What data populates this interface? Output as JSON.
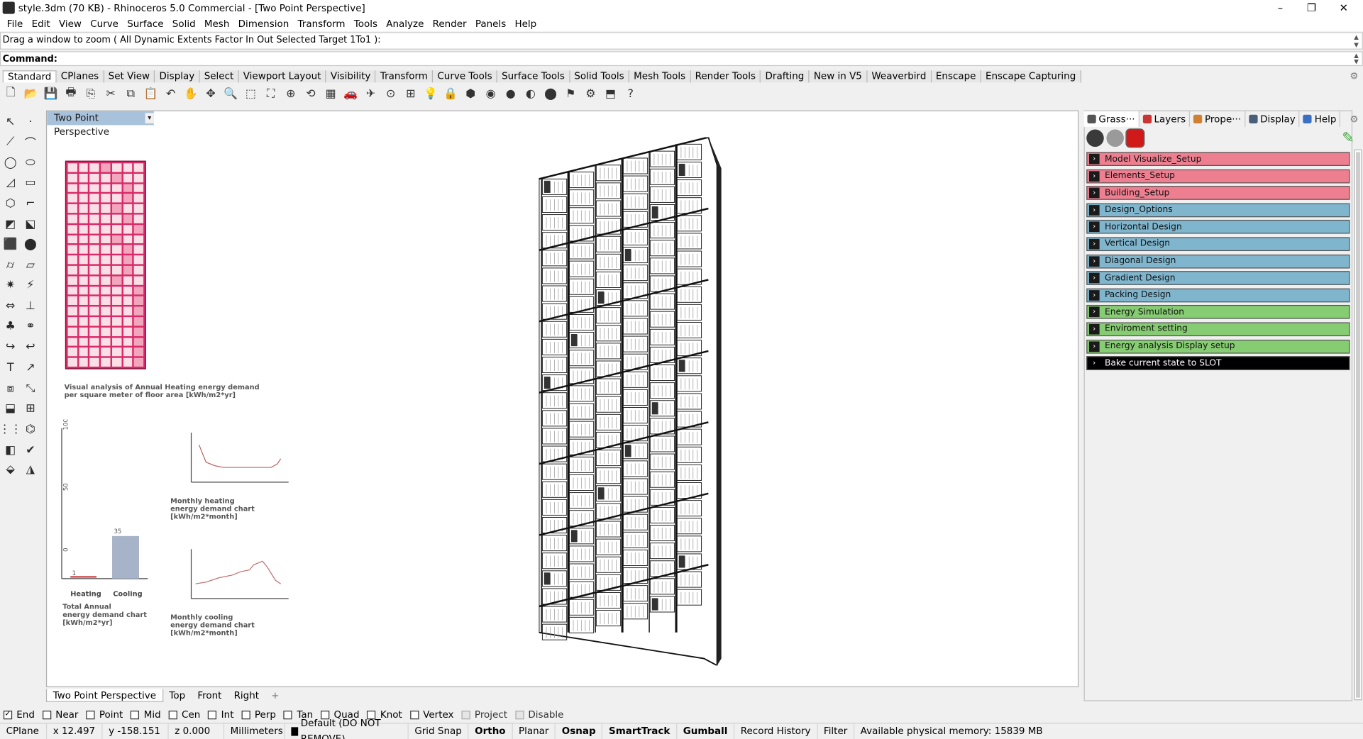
{
  "window": {
    "title": "style.3dm (70 KB) - Rhinoceros 5.0 Commercial - [Two Point Perspective]",
    "minimize_glyph": "–",
    "maximize_glyph": "❐",
    "close_glyph": "✕"
  },
  "menu": [
    "File",
    "Edit",
    "View",
    "Curve",
    "Surface",
    "Solid",
    "Mesh",
    "Dimension",
    "Transform",
    "Tools",
    "Analyze",
    "Render",
    "Panels",
    "Help"
  ],
  "command": {
    "history": "Drag a window to zoom ( All  Dynamic  Extents  Factor  In  Out  Selected  Target  1To1 ):",
    "label": "Command:",
    "value": ""
  },
  "toolbar_tabs": [
    "Standard",
    "CPlanes",
    "Set View",
    "Display",
    "Select",
    "Viewport Layout",
    "Visibility",
    "Transform",
    "Curve Tools",
    "Surface Tools",
    "Solid Tools",
    "Mesh Tools",
    "Render Tools",
    "Drafting",
    "New in V5",
    "Weaverbird",
    "Enscape",
    "Enscape Capturing"
  ],
  "toolbar_icons": [
    {
      "name": "new-file-icon",
      "glyph": "🗋"
    },
    {
      "name": "open-icon",
      "glyph": "📂"
    },
    {
      "name": "save-icon",
      "glyph": "💾"
    },
    {
      "name": "print-icon",
      "glyph": "🖶"
    },
    {
      "name": "export-icon",
      "glyph": "⎘"
    },
    {
      "name": "cut-icon",
      "glyph": "✂"
    },
    {
      "name": "copy-icon",
      "glyph": "⧉"
    },
    {
      "name": "paste-icon",
      "glyph": "📋"
    },
    {
      "name": "undo-icon",
      "glyph": "↶"
    },
    {
      "name": "pan-icon",
      "glyph": "✋"
    },
    {
      "name": "rotate-view-icon",
      "glyph": "✥"
    },
    {
      "name": "zoom-icon",
      "glyph": "🔍"
    },
    {
      "name": "zoom-window-icon",
      "glyph": "⬚"
    },
    {
      "name": "zoom-extents-icon",
      "glyph": "⛶"
    },
    {
      "name": "zoom-selected-icon",
      "glyph": "⊕"
    },
    {
      "name": "undo-view-icon",
      "glyph": "⟲"
    },
    {
      "name": "viewport-layout-icon",
      "glyph": "▦"
    },
    {
      "name": "car-icon",
      "glyph": "🚗"
    },
    {
      "name": "plane-icon",
      "glyph": "✈"
    },
    {
      "name": "cplane-icon",
      "glyph": "⊙"
    },
    {
      "name": "grid-icon",
      "glyph": "⊞"
    },
    {
      "name": "light-icon",
      "glyph": "💡"
    },
    {
      "name": "lock-icon",
      "glyph": "🔒"
    },
    {
      "name": "material-icon",
      "glyph": "⬢"
    },
    {
      "name": "color-icon",
      "glyph": "◉"
    },
    {
      "name": "shade-icon",
      "glyph": "●"
    },
    {
      "name": "rendered-icon",
      "glyph": "◐"
    },
    {
      "name": "sphere-icon",
      "glyph": "⬤"
    },
    {
      "name": "flag-icon",
      "glyph": "⚑"
    },
    {
      "name": "options-icon",
      "glyph": "⚙"
    },
    {
      "name": "properties-icon",
      "glyph": "⬒"
    },
    {
      "name": "help-icon",
      "glyph": "?"
    }
  ],
  "left_tools": [
    {
      "name": "select-icon",
      "glyph": "↖"
    },
    {
      "name": "point-icon",
      "glyph": "·"
    },
    {
      "name": "polyline-icon",
      "glyph": "⟋"
    },
    {
      "name": "curve-icon",
      "glyph": "⌒"
    },
    {
      "name": "circle-icon",
      "glyph": "◯"
    },
    {
      "name": "ellipse-icon",
      "glyph": "⬭"
    },
    {
      "name": "arc-icon",
      "glyph": "◿"
    },
    {
      "name": "rectangle-icon",
      "glyph": "▭"
    },
    {
      "name": "polygon-icon",
      "glyph": "⬡"
    },
    {
      "name": "fillet-icon",
      "glyph": "⌐"
    },
    {
      "name": "surface-icon",
      "glyph": "◩"
    },
    {
      "name": "extrude-icon",
      "glyph": "⬕"
    },
    {
      "name": "box-icon",
      "glyph": "⬛"
    },
    {
      "name": "boolean-icon",
      "glyph": "⬤"
    },
    {
      "name": "cylinder-icon",
      "glyph": "⌭"
    },
    {
      "name": "plane-surface-icon",
      "glyph": "▱"
    },
    {
      "name": "gear-tool-icon",
      "glyph": "✷"
    },
    {
      "name": "lightning-icon",
      "glyph": "⚡"
    },
    {
      "name": "move-icon",
      "glyph": "⇔"
    },
    {
      "name": "transform-icon",
      "glyph": "⊥"
    },
    {
      "name": "group-icon",
      "glyph": "♣"
    },
    {
      "name": "ungroup-icon",
      "glyph": "⚭"
    },
    {
      "name": "pipe-icon",
      "glyph": "↪"
    },
    {
      "name": "sweep-icon",
      "glyph": "↩"
    },
    {
      "name": "text-icon",
      "glyph": "T"
    },
    {
      "name": "dimension-icon",
      "glyph": "↗"
    },
    {
      "name": "block-icon",
      "glyph": "⧈"
    },
    {
      "name": "scale-icon",
      "glyph": "⤡"
    },
    {
      "name": "mesh-icon",
      "glyph": "⬓"
    },
    {
      "name": "hatch-icon",
      "glyph": "⊞"
    },
    {
      "name": "array-icon",
      "glyph": "⋮⋮"
    },
    {
      "name": "gumball-icon",
      "glyph": "⌬"
    },
    {
      "name": "cage-icon",
      "glyph": "◧"
    },
    {
      "name": "check-icon",
      "glyph": "✔"
    },
    {
      "name": "render-tool-icon",
      "glyph": "⬙"
    },
    {
      "name": "paint-icon",
      "glyph": "◮"
    }
  ],
  "viewport": {
    "title": "Two Point Perspective",
    "dropdown_glyph": "▾",
    "annual_caption_1": "Visual analysis of Annual Heating energy demand",
    "annual_caption_2": "per square meter of floor area [kWh/m2*yr]",
    "bar_axis_100": "100",
    "bar_axis_50": "50",
    "bar_axis_0": "0",
    "bar_value_heating": "1",
    "bar_value_cooling": "35",
    "bar_label_heating": "Heating",
    "bar_label_cooling": "Cooling",
    "total_caption_1": "Total Annual",
    "total_caption_2": "energy demand chart",
    "total_caption_3": "[kWh/m2*yr]",
    "heating_caption_1": "Monthly heating",
    "heating_caption_2": "energy demand chart",
    "heating_caption_3": "[kWh/m2*month]",
    "cooling_caption_1": "Monthly cooling",
    "cooling_caption_2": "energy demand chart",
    "cooling_caption_3": "[kWh/m2*month]"
  },
  "viewport_tabs": [
    "Two Point Perspective",
    "Top",
    "Front",
    "Right"
  ],
  "add_tab_glyph": "+",
  "panel_tabs": [
    {
      "label": "Grass···",
      "color": "#555555"
    },
    {
      "label": "Layers",
      "color": "#cc3333"
    },
    {
      "label": "Prope···",
      "color": "#d08030"
    },
    {
      "label": "Display",
      "color": "#4a5d7a"
    },
    {
      "label": "Help",
      "color": "#3a6fc4"
    }
  ],
  "grasshopper_groups": [
    {
      "label": "Model Visualize_Setup",
      "color": "pink"
    },
    {
      "label": "Elements_Setup",
      "color": "pink"
    },
    {
      "label": "Building_Setup",
      "color": "pink"
    },
    {
      "label": "Design_Options",
      "color": "blue"
    },
    {
      "label": "Horizontal Design",
      "color": "blue"
    },
    {
      "label": "Vertical Design",
      "color": "blue"
    },
    {
      "label": "Diagonal Design",
      "color": "blue"
    },
    {
      "label": "Gradient Design",
      "color": "blue"
    },
    {
      "label": "Packing Design",
      "color": "blue"
    },
    {
      "label": "Energy Simulation",
      "color": "green"
    },
    {
      "label": "Enviroment setting",
      "color": "green"
    },
    {
      "label": "Energy analysis Display setup",
      "color": "green"
    },
    {
      "label": "Bake current state to SLOT",
      "color": "black"
    }
  ],
  "osnaps": [
    {
      "label": "End",
      "checked": true
    },
    {
      "label": "Near",
      "checked": false
    },
    {
      "label": "Point",
      "checked": false
    },
    {
      "label": "Mid",
      "checked": false
    },
    {
      "label": "Cen",
      "checked": false
    },
    {
      "label": "Int",
      "checked": false
    },
    {
      "label": "Perp",
      "checked": false
    },
    {
      "label": "Tan",
      "checked": false
    },
    {
      "label": "Quad",
      "checked": false
    },
    {
      "label": "Knot",
      "checked": false
    },
    {
      "label": "Vertex",
      "checked": false
    },
    {
      "label": "Project",
      "checked": false,
      "disabled": true
    },
    {
      "label": "Disable",
      "checked": false,
      "disabled": true
    }
  ],
  "status": {
    "cplane": "CPlane",
    "x": "x 12.497",
    "y": "y -158.151",
    "z": "z 0.000",
    "units": "Millimeters",
    "layer": "Default (DO NOT REMOVE)",
    "grid_snap": "Grid Snap",
    "ortho": "Ortho",
    "planar": "Planar",
    "osnap": "Osnap",
    "smarttrack": "SmartTrack",
    "gumball": "Gumball",
    "record_history": "Record History",
    "filter": "Filter",
    "memory": "Available physical memory: 15839 MB"
  }
}
